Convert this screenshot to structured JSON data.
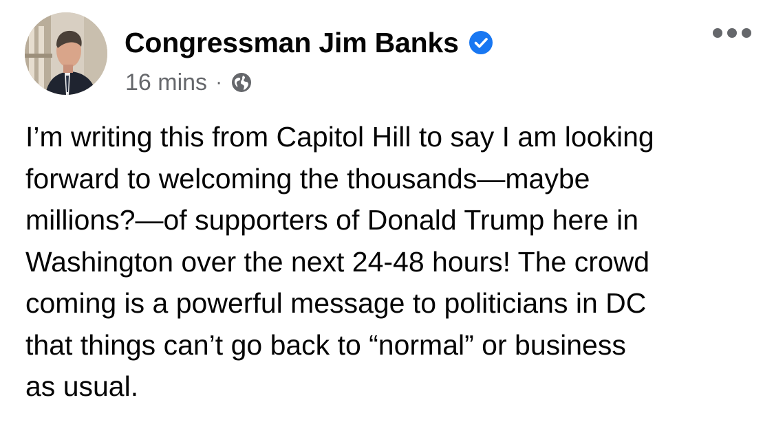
{
  "post": {
    "author": "Congressman Jim Banks",
    "verified": true,
    "timestamp": "16 mins",
    "separator": "·",
    "audience_icon": "globe-icon",
    "more_icon": "more-options-icon",
    "text_lines": [
      "I’m writing this from Capitol Hill to say I am looking",
      "forward to welcoming the thousands—maybe",
      "millions?—of supporters of Donald Trump here in",
      "Washington over the next 24-48 hours! The crowd",
      "coming is a powerful message to politicians in DC",
      "that things can’t go back to “normal” or business",
      "as usual."
    ]
  },
  "colors": {
    "text_primary": "#050505",
    "text_secondary": "#65676b",
    "verified_badge": "#1877f2",
    "background": "#ffffff"
  }
}
